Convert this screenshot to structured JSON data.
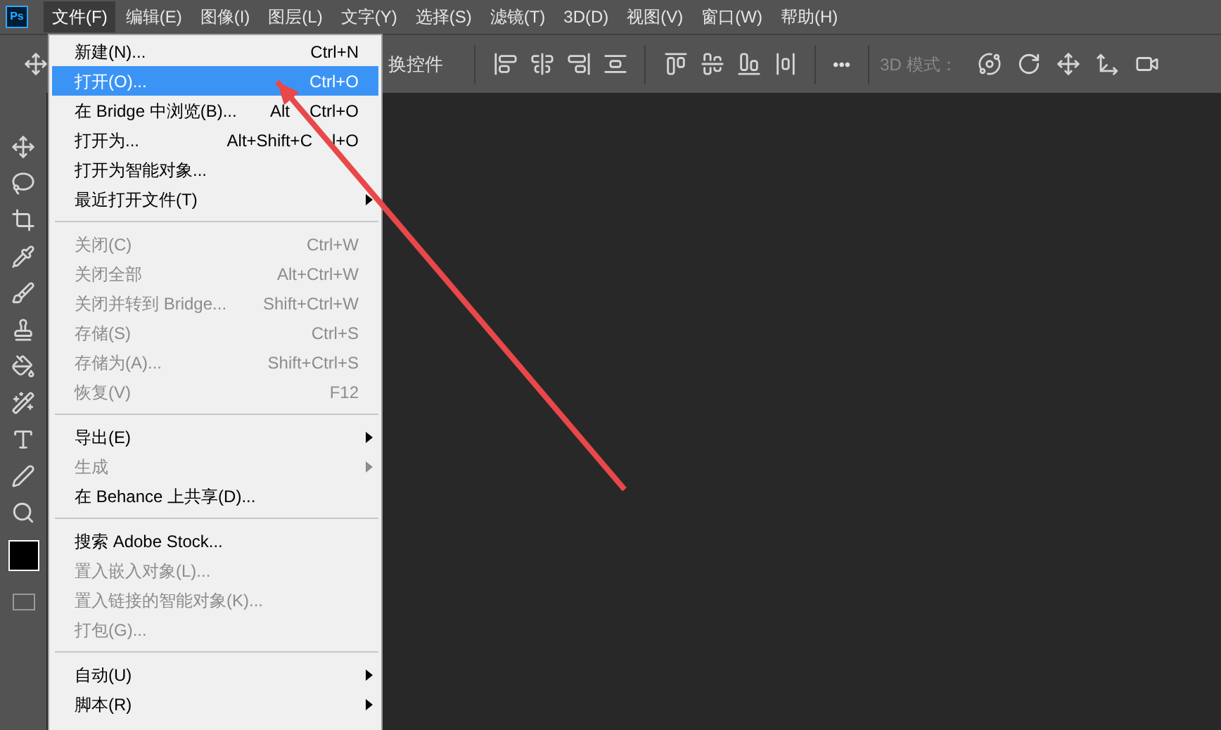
{
  "app_logo": "Ps",
  "menubar": [
    {
      "label": "文件(F)",
      "selected": true
    },
    {
      "label": "编辑(E)",
      "selected": false
    },
    {
      "label": "图像(I)",
      "selected": false
    },
    {
      "label": "图层(L)",
      "selected": false
    },
    {
      "label": "文字(Y)",
      "selected": false
    },
    {
      "label": "选择(S)",
      "selected": false
    },
    {
      "label": "滤镜(T)",
      "selected": false
    },
    {
      "label": "3D(D)",
      "selected": false
    },
    {
      "label": "视图(V)",
      "selected": false
    },
    {
      "label": "窗口(W)",
      "selected": false
    },
    {
      "label": "帮助(H)",
      "selected": false
    }
  ],
  "options_bar": {
    "partial_label": "换控件",
    "more": "•••",
    "mode_label": "3D 模式："
  },
  "file_menu": [
    {
      "kind": "item",
      "label": "新建(N)...",
      "shortcut": "Ctrl+N",
      "disabled": false,
      "selected": false,
      "submenu": false
    },
    {
      "kind": "item",
      "label": "打开(O)...",
      "shortcut": "Ctrl+O",
      "disabled": false,
      "selected": true,
      "submenu": false
    },
    {
      "kind": "item",
      "label": "在 Bridge 中浏览(B)...",
      "shortcut_parts": [
        "Alt",
        "Ctrl+O"
      ],
      "disabled": false,
      "selected": false,
      "submenu": false
    },
    {
      "kind": "item",
      "label": "打开为...",
      "shortcut_parts": [
        "Alt+Shift+C",
        "l+O"
      ],
      "disabled": false,
      "selected": false,
      "submenu": false
    },
    {
      "kind": "item",
      "label": "打开为智能对象...",
      "disabled": false,
      "selected": false,
      "submenu": false
    },
    {
      "kind": "item",
      "label": "最近打开文件(T)",
      "disabled": false,
      "selected": false,
      "submenu": true
    },
    {
      "kind": "separator"
    },
    {
      "kind": "item",
      "label": "关闭(C)",
      "shortcut": "Ctrl+W",
      "disabled": true,
      "selected": false,
      "submenu": false
    },
    {
      "kind": "item",
      "label": "关闭全部",
      "shortcut": "Alt+Ctrl+W",
      "disabled": true,
      "selected": false,
      "submenu": false
    },
    {
      "kind": "item",
      "label": "关闭并转到 Bridge...",
      "shortcut": "Shift+Ctrl+W",
      "disabled": true,
      "selected": false,
      "submenu": false
    },
    {
      "kind": "item",
      "label": "存储(S)",
      "shortcut": "Ctrl+S",
      "disabled": true,
      "selected": false,
      "submenu": false
    },
    {
      "kind": "item",
      "label": "存储为(A)...",
      "shortcut": "Shift+Ctrl+S",
      "disabled": true,
      "selected": false,
      "submenu": false
    },
    {
      "kind": "item",
      "label": "恢复(V)",
      "shortcut": "F12",
      "disabled": true,
      "selected": false,
      "submenu": false
    },
    {
      "kind": "separator"
    },
    {
      "kind": "item",
      "label": "导出(E)",
      "disabled": false,
      "selected": false,
      "submenu": true
    },
    {
      "kind": "item",
      "label": "生成",
      "disabled": true,
      "selected": false,
      "submenu": true
    },
    {
      "kind": "item",
      "label": "在 Behance 上共享(D)...",
      "disabled": false,
      "selected": false,
      "submenu": false
    },
    {
      "kind": "separator"
    },
    {
      "kind": "item",
      "label": "搜索 Adobe Stock...",
      "disabled": false,
      "selected": false,
      "submenu": false
    },
    {
      "kind": "item",
      "label": "置入嵌入对象(L)...",
      "disabled": true,
      "selected": false,
      "submenu": false
    },
    {
      "kind": "item",
      "label": "置入链接的智能对象(K)...",
      "disabled": true,
      "selected": false,
      "submenu": false
    },
    {
      "kind": "item",
      "label": "打包(G)...",
      "disabled": true,
      "selected": false,
      "submenu": false
    },
    {
      "kind": "separator"
    },
    {
      "kind": "item",
      "label": "自动(U)",
      "disabled": false,
      "selected": false,
      "submenu": true
    },
    {
      "kind": "item",
      "label": "脚本(R)",
      "disabled": false,
      "selected": false,
      "submenu": true
    }
  ]
}
